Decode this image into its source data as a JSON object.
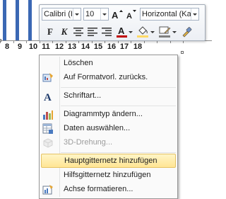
{
  "chart": {
    "x_axis_labels": [
      "8",
      "9",
      "10",
      "11",
      "12",
      "13",
      "14",
      "15",
      "16",
      "17",
      "18"
    ],
    "bar_color": "#3b68b4"
  },
  "mini_toolbar": {
    "font_name": "Calibri (I",
    "font_size": "10",
    "alignment": "Horizontal (Kat",
    "grow_font_icon": "font-grow-icon",
    "shrink_font_icon": "font-shrink-icon",
    "bold_label": "F",
    "italic_label": "K",
    "font_color_label": "A",
    "font_color": "#c00000",
    "fill_color": "#ffd966",
    "outline_color": "#7f7f7f"
  },
  "context_menu": {
    "items": [
      {
        "label": "Löschen",
        "icon": "none",
        "enabled": true
      },
      {
        "label": "Auf Formatvorl. zurücks.",
        "icon": "reset-style-icon",
        "enabled": true
      },
      {
        "label": "Schriftart...",
        "icon": "font-icon",
        "enabled": true
      },
      {
        "label": "Diagrammtyp ändern...",
        "icon": "chart-type-icon",
        "enabled": true
      },
      {
        "label": "Daten auswählen...",
        "icon": "select-data-icon",
        "enabled": true
      },
      {
        "label": "3D-Drehung...",
        "icon": "3d-rotation-icon",
        "enabled": false
      },
      {
        "label": "Hauptgitternetz hinzufügen",
        "icon": "none",
        "enabled": true,
        "highlighted": true
      },
      {
        "label": "Hilfsgitternetz hinzufügen",
        "icon": "none",
        "enabled": true
      },
      {
        "label": "Achse formatieren...",
        "icon": "format-axis-icon",
        "enabled": true
      }
    ]
  }
}
